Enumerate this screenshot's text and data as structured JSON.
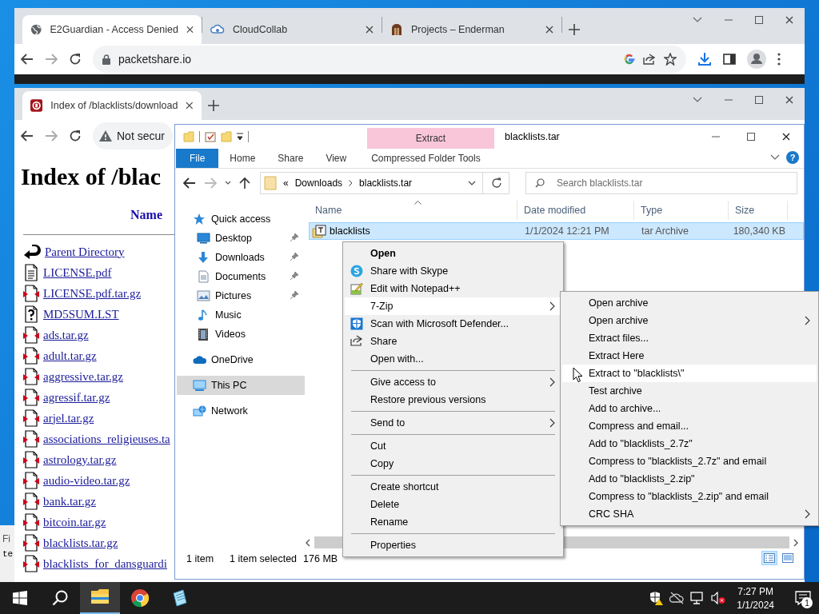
{
  "back_browser": {
    "tabs": [
      {
        "title": "E2Guardian - Access Denied",
        "selected": true
      },
      {
        "title": "CloudCollab",
        "selected": false
      },
      {
        "title": "Projects – Enderman",
        "selected": false
      }
    ],
    "address": "packetshare.io"
  },
  "background_window": {
    "texts": [
      "Fi",
      "te"
    ]
  },
  "front_browser": {
    "tabs": [
      {
        "title": "Index of /blacklists/download",
        "selected": true
      }
    ],
    "address": "Not secur",
    "page": {
      "heading": "Index of /blac",
      "column": "Name",
      "entries": [
        {
          "name": "Parent Directory",
          "kind": "parent"
        },
        {
          "name": "LICENSE.pdf",
          "kind": "text"
        },
        {
          "name": "LICENSE.pdf.tar.gz",
          "kind": "compressed"
        },
        {
          "name": "MD5SUM.LST",
          "kind": "unknown"
        },
        {
          "name": "ads.tar.gz",
          "kind": "compressed"
        },
        {
          "name": "adult.tar.gz",
          "kind": "compressed"
        },
        {
          "name": "aggressive.tar.gz",
          "kind": "compressed"
        },
        {
          "name": "agressif.tar.gz",
          "kind": "compressed"
        },
        {
          "name": "arjel.tar.gz",
          "kind": "compressed"
        },
        {
          "name": "associations_religieuses.ta",
          "kind": "compressed"
        },
        {
          "name": "astrology.tar.gz",
          "kind": "compressed"
        },
        {
          "name": "audio-video.tar.gz",
          "kind": "compressed"
        },
        {
          "name": "bank.tar.gz",
          "kind": "compressed"
        },
        {
          "name": "bitcoin.tar.gz",
          "kind": "compressed"
        },
        {
          "name": "blacklists.tar.gz",
          "kind": "compressed"
        },
        {
          "name": "blacklists_for_dansguardi",
          "kind": "compressed"
        }
      ]
    }
  },
  "explorer": {
    "title": "blacklists.tar",
    "context_tab": "Extract",
    "ribbon_tabs": [
      {
        "label": "File",
        "kind": "file"
      },
      {
        "label": "Home",
        "kind": "tab"
      },
      {
        "label": "Share",
        "kind": "tab"
      },
      {
        "label": "View",
        "kind": "tab"
      },
      {
        "label": "Compressed Folder Tools",
        "kind": "context"
      }
    ],
    "help": "?",
    "breadcrumb": {
      "overflow": "«",
      "parts": [
        "Downloads",
        "blacklists.tar"
      ]
    },
    "search": {
      "placeholder": "Search blacklists.tar"
    },
    "navigation": [
      {
        "label": "Quick access",
        "selected": false,
        "children": [
          {
            "label": "Desktop",
            "pinned": true,
            "selected": false
          },
          {
            "label": "Downloads",
            "pinned": true,
            "selected": false
          },
          {
            "label": "Documents",
            "pinned": true,
            "selected": false
          },
          {
            "label": "Pictures",
            "pinned": true,
            "selected": false
          },
          {
            "label": "Music",
            "pinned": false,
            "selected": false
          },
          {
            "label": "Videos",
            "pinned": false,
            "selected": false
          }
        ]
      },
      {
        "label": "OneDrive",
        "selected": false
      },
      {
        "label": "This PC",
        "selected": true
      },
      {
        "label": "Network",
        "selected": false
      }
    ],
    "columns": [
      "Name",
      "Date modified",
      "Type",
      "Size"
    ],
    "rows": [
      {
        "name": "blacklists",
        "date": "1/1/2024 12:21 PM",
        "type": "tar Archive",
        "size": "180,340 KB",
        "selected": true
      }
    ],
    "status": {
      "count": "1 item",
      "selection": "1 item selected",
      "size": "176 MB"
    },
    "views": [
      {
        "kind": "details",
        "selected": true
      },
      {
        "kind": "large-icons",
        "selected": false
      }
    ]
  },
  "context_menu": [
    {
      "kind": "entry",
      "label": "Open",
      "bold": true,
      "submenu": false,
      "highlighted": false
    },
    {
      "kind": "entry",
      "label": "Share with Skype",
      "bold": false,
      "submenu": false,
      "highlighted": false
    },
    {
      "kind": "entry",
      "label": "Edit with Notepad++",
      "bold": false,
      "submenu": false,
      "highlighted": false
    },
    {
      "kind": "entry",
      "label": "7-Zip",
      "bold": false,
      "submenu": true,
      "highlighted": true
    },
    {
      "kind": "entry",
      "label": "Scan with Microsoft Defender...",
      "bold": false,
      "submenu": false,
      "highlighted": false
    },
    {
      "kind": "entry",
      "label": "Share",
      "bold": false,
      "submenu": false,
      "highlighted": false
    },
    {
      "kind": "entry",
      "label": "Open with...",
      "bold": false,
      "submenu": false,
      "highlighted": false
    },
    {
      "kind": "separator"
    },
    {
      "kind": "entry",
      "label": "Give access to",
      "bold": false,
      "submenu": true,
      "highlighted": false
    },
    {
      "kind": "entry",
      "label": "Restore previous versions",
      "bold": false,
      "submenu": false,
      "highlighted": false
    },
    {
      "kind": "separator"
    },
    {
      "kind": "entry",
      "label": "Send to",
      "bold": false,
      "submenu": true,
      "highlighted": false
    },
    {
      "kind": "separator"
    },
    {
      "kind": "entry",
      "label": "Cut",
      "bold": false,
      "submenu": false,
      "highlighted": false
    },
    {
      "kind": "entry",
      "label": "Copy",
      "bold": false,
      "submenu": false,
      "highlighted": false
    },
    {
      "kind": "separator"
    },
    {
      "kind": "entry",
      "label": "Create shortcut",
      "bold": false,
      "submenu": false,
      "highlighted": false
    },
    {
      "kind": "entry",
      "label": "Delete",
      "bold": false,
      "submenu": false,
      "highlighted": false
    },
    {
      "kind": "entry",
      "label": "Rename",
      "bold": false,
      "submenu": false,
      "highlighted": false
    },
    {
      "kind": "separator"
    },
    {
      "kind": "entry",
      "label": "Properties",
      "bold": false,
      "submenu": false,
      "highlighted": false
    }
  ],
  "zip_menu": [
    {
      "label": "Open archive",
      "submenu": false,
      "highlighted": false
    },
    {
      "label": "Open archive",
      "submenu": true,
      "highlighted": false
    },
    {
      "label": "Extract files...",
      "submenu": false,
      "highlighted": false
    },
    {
      "label": "Extract Here",
      "submenu": false,
      "highlighted": false
    },
    {
      "label": "Extract to \"blacklists\\\"",
      "submenu": false,
      "highlighted": true
    },
    {
      "label": "Test archive",
      "submenu": false,
      "highlighted": false
    },
    {
      "label": "Add to archive...",
      "submenu": false,
      "highlighted": false
    },
    {
      "label": "Compress and email...",
      "submenu": false,
      "highlighted": false
    },
    {
      "label": "Add to \"blacklists_2.7z\"",
      "submenu": false,
      "highlighted": false
    },
    {
      "label": "Compress to \"blacklists_2.7z\" and email",
      "submenu": false,
      "highlighted": false
    },
    {
      "label": "Add to \"blacklists_2.zip\"",
      "submenu": false,
      "highlighted": false
    },
    {
      "label": "Compress to \"blacklists_2.zip\" and email",
      "submenu": false,
      "highlighted": false
    },
    {
      "label": "CRC SHA",
      "submenu": true,
      "highlighted": false
    }
  ],
  "taskbar": {
    "apps": [
      {
        "kind": "explorer",
        "active": true
      },
      {
        "kind": "chrome",
        "active": false
      },
      {
        "kind": "app",
        "active": false
      }
    ],
    "time": "7:27 PM",
    "date": "1/1/2024",
    "notifications": "1"
  }
}
